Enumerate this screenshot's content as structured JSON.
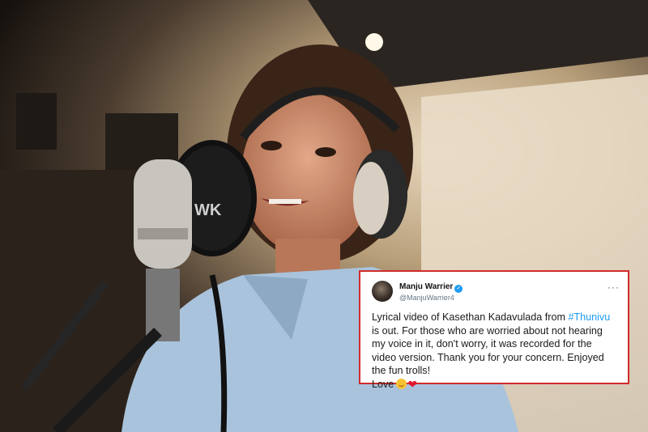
{
  "tweet": {
    "display_name": "Manju Warrier",
    "handle": "@ManjuWarrier4",
    "more_label": "···",
    "text_before_hashtag": "Lyrical video of Kasethan Kadavulada from ",
    "hashtag": "#Thunivu",
    "text_after_hashtag": " is out. For those who are worried about not hearing my voice in it, don't worry, it was recorded for the video version. Thank you for your concern. Enjoyed the fun trolls!",
    "sign_off": "Love",
    "emojis": [
      "smiling-face-icon",
      "red-heart-icon"
    ]
  },
  "scene": {
    "mic_shield_text": "WK"
  },
  "colors": {
    "card_border": "#d22b2b",
    "hashtag": "#1d9bf0",
    "verified": "#1d9bf0"
  }
}
